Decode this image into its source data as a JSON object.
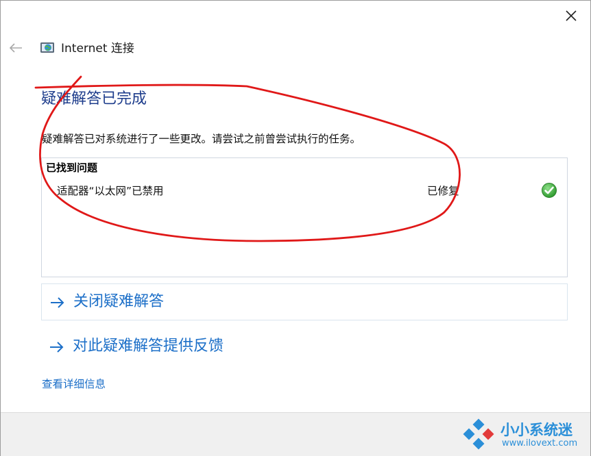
{
  "window": {
    "title": "Internet 连接"
  },
  "header": {
    "heading": "疑难解答已完成",
    "description": "疑难解答已对系统进行了一些更改。请尝试之前曾尝试执行的任务。"
  },
  "results": {
    "title": "已找到问题",
    "problems": [
      {
        "description": "适配器“以太网”已禁用",
        "status": "已修复",
        "icon": "check-icon"
      }
    ]
  },
  "actions": {
    "close_label": "关闭疑难解答",
    "feedback_label": "对此疑难解答提供反馈"
  },
  "links": {
    "details": "查看详细信息"
  },
  "watermark": {
    "title": "小小系统迷",
    "url": "www.ilovext.com"
  },
  "colors": {
    "heading": "#1e3d8c",
    "link": "#1c6fc8",
    "annotation": "#e01818",
    "success": "#3aa63a"
  }
}
